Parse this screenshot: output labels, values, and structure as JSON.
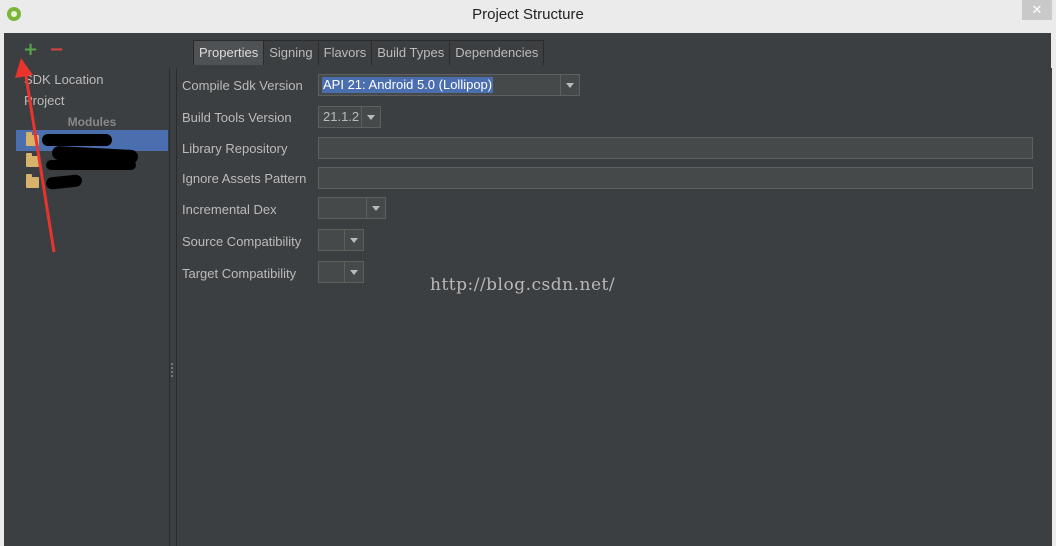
{
  "window": {
    "title": "Project Structure",
    "close_glyph": "✕"
  },
  "sidebar": {
    "add_glyph": "+",
    "remove_glyph": "−",
    "items": [
      {
        "label": "SDK Location"
      },
      {
        "label": "Project"
      }
    ],
    "modules_header": "Modules"
  },
  "tabs": [
    {
      "label": "Properties",
      "active": true
    },
    {
      "label": "Signing"
    },
    {
      "label": "Flavors"
    },
    {
      "label": "Build Types"
    },
    {
      "label": "Dependencies"
    }
  ],
  "form": {
    "compile_sdk": {
      "label": "Compile Sdk Version",
      "value": "API 21: Android 5.0 (Lollipop)"
    },
    "build_tools": {
      "label": "Build Tools Version",
      "value": "21.1.2"
    },
    "library_repo": {
      "label": "Library Repository",
      "value": ""
    },
    "ignore_assets": {
      "label": "Ignore Assets Pattern",
      "value": ""
    },
    "incremental_dex": {
      "label": "Incremental Dex",
      "value": ""
    },
    "source_compat": {
      "label": "Source Compatibility",
      "value": ""
    },
    "target_compat": {
      "label": "Target Compatibility",
      "value": ""
    }
  },
  "watermark": "http://blog.csdn.net/",
  "colors": {
    "background": "#3c3f41",
    "selection": "#4b6eaf",
    "add": "#59a54a",
    "remove": "#d2453f",
    "annotation_arrow": "#e8342c"
  }
}
